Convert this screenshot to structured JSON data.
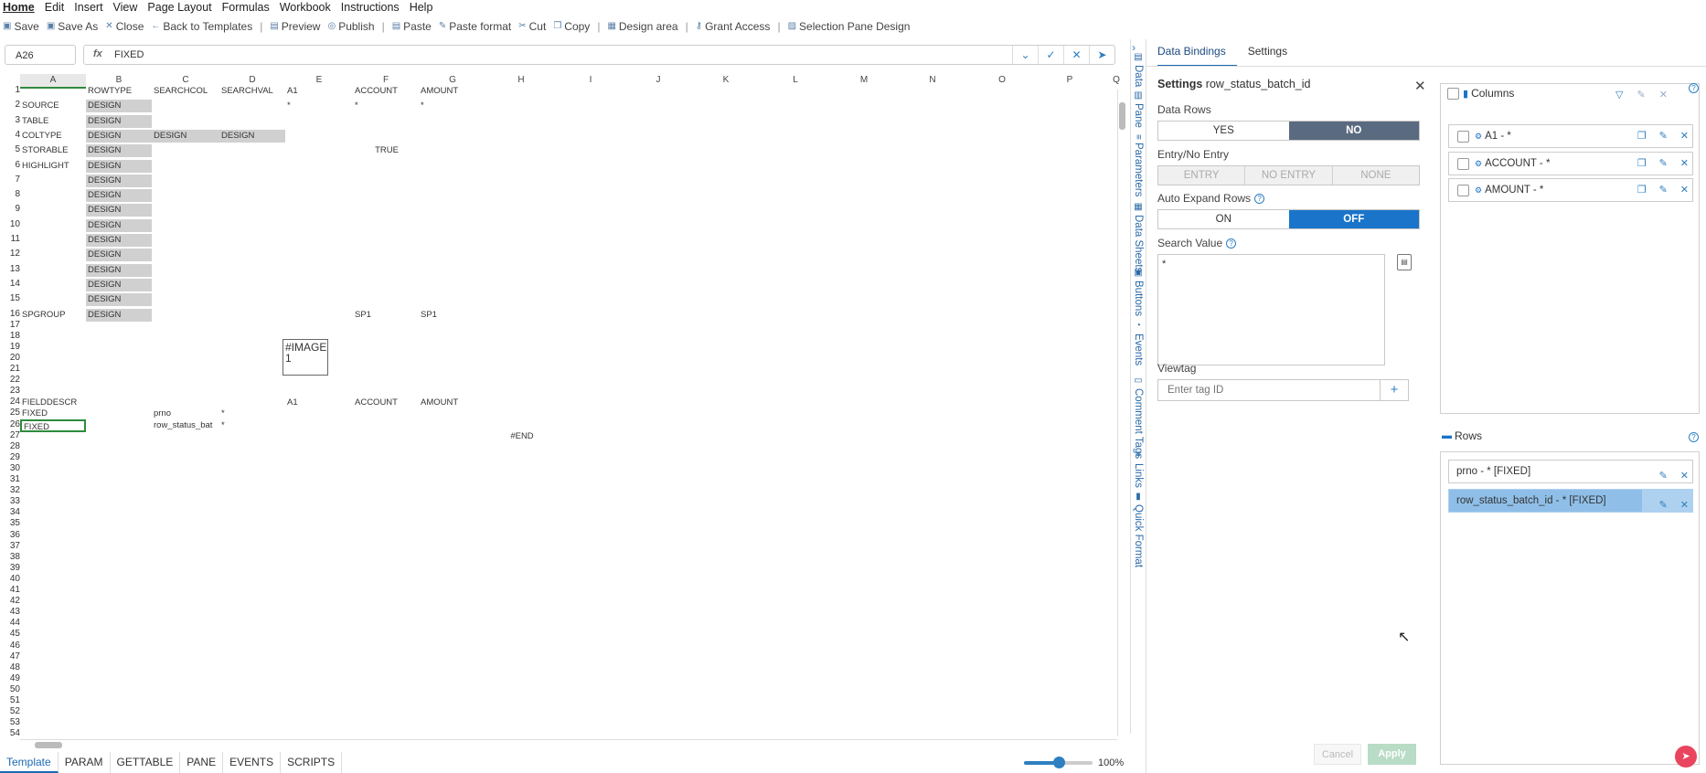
{
  "menu": [
    "Home",
    "Edit",
    "Insert",
    "View",
    "Page Layout",
    "Formulas",
    "Workbook",
    "Instructions",
    "Help"
  ],
  "toolbar": [
    {
      "label": "Save",
      "icon": "save-icon"
    },
    {
      "label": "Save As",
      "icon": "save-as-icon"
    },
    {
      "label": "Close",
      "icon": "close-icon"
    },
    {
      "label": "Back to Templates",
      "icon": "arrow-left-icon"
    },
    {
      "label": "Preview",
      "icon": "preview-icon"
    },
    {
      "label": "Publish",
      "icon": "publish-icon"
    },
    {
      "label": "Paste",
      "icon": "paste-icon"
    },
    {
      "label": "Paste format",
      "icon": "paste-format-icon"
    },
    {
      "label": "Cut",
      "icon": "cut-icon"
    },
    {
      "label": "Copy",
      "icon": "copy-icon"
    },
    {
      "label": "Design area",
      "icon": "design-area-icon"
    },
    {
      "label": "Grant Access",
      "icon": "key-icon"
    },
    {
      "label": "Selection Pane Design",
      "icon": "selection-pane-icon"
    }
  ],
  "formula_bar": {
    "cell_ref": "A26",
    "fx": "fx",
    "value": "FIXED"
  },
  "grid": {
    "columns": [
      "A",
      "B",
      "C",
      "D",
      "E",
      "F",
      "G",
      "H",
      "I",
      "J",
      "K",
      "L",
      "M",
      "N",
      "O",
      "P",
      "Q"
    ],
    "selected_column": "A",
    "row_count": 54,
    "selected_cell": "A26",
    "image_text": [
      "#IMAGE",
      "1"
    ],
    "cells": [
      {
        "r": 1,
        "c": "B",
        "t": "ROWTYPE"
      },
      {
        "r": 1,
        "c": "C",
        "t": "SEARCHCOL"
      },
      {
        "r": 1,
        "c": "D",
        "t": "SEARCHVAL"
      },
      {
        "r": 1,
        "c": "E",
        "t": "A1"
      },
      {
        "r": 1,
        "c": "F",
        "t": "ACCOUNT"
      },
      {
        "r": 1,
        "c": "G",
        "t": "AMOUNT"
      },
      {
        "r": 2,
        "c": "A",
        "t": "SOURCE"
      },
      {
        "r": 2,
        "c": "B",
        "t": "DESIGN",
        "g": true
      },
      {
        "r": 2,
        "c": "E",
        "t": "*"
      },
      {
        "r": 2,
        "c": "F",
        "t": "*"
      },
      {
        "r": 2,
        "c": "G",
        "t": "*"
      },
      {
        "r": 3,
        "c": "A",
        "t": "TABLE"
      },
      {
        "r": 3,
        "c": "B",
        "t": "DESIGN",
        "g": true
      },
      {
        "r": 4,
        "c": "A",
        "t": "COLTYPE"
      },
      {
        "r": 4,
        "c": "B",
        "t": "DESIGN",
        "g": true
      },
      {
        "r": 4,
        "c": "C",
        "t": "DESIGN",
        "g": true
      },
      {
        "r": 4,
        "c": "D",
        "t": "DESIGN",
        "g": true
      },
      {
        "r": 5,
        "c": "A",
        "t": "STORABLE"
      },
      {
        "r": 5,
        "c": "B",
        "t": "DESIGN",
        "g": true
      },
      {
        "r": 5,
        "c": "F",
        "t": "TRUE",
        "center": true
      },
      {
        "r": 6,
        "c": "A",
        "t": "HIGHLIGHT"
      },
      {
        "r": 6,
        "c": "B",
        "t": "DESIGN",
        "g": true
      },
      {
        "r": 7,
        "c": "B",
        "t": "DESIGN",
        "g": true
      },
      {
        "r": 8,
        "c": "B",
        "t": "DESIGN",
        "g": true
      },
      {
        "r": 9,
        "c": "B",
        "t": "DESIGN",
        "g": true
      },
      {
        "r": 10,
        "c": "B",
        "t": "DESIGN",
        "g": true
      },
      {
        "r": 11,
        "c": "B",
        "t": "DESIGN",
        "g": true
      },
      {
        "r": 12,
        "c": "B",
        "t": "DESIGN",
        "g": true
      },
      {
        "r": 13,
        "c": "B",
        "t": "DESIGN",
        "g": true
      },
      {
        "r": 14,
        "c": "B",
        "t": "DESIGN",
        "g": true
      },
      {
        "r": 15,
        "c": "B",
        "t": "DESIGN",
        "g": true
      },
      {
        "r": 16,
        "c": "A",
        "t": "SPGROUP"
      },
      {
        "r": 16,
        "c": "B",
        "t": "DESIGN",
        "g": true
      },
      {
        "r": 16,
        "c": "F",
        "t": "SP1"
      },
      {
        "r": 16,
        "c": "G",
        "t": "SP1"
      },
      {
        "r": 24,
        "c": "A",
        "t": "FIELDDESCR"
      },
      {
        "r": 24,
        "c": "E",
        "t": "A1"
      },
      {
        "r": 24,
        "c": "F",
        "t": "ACCOUNT"
      },
      {
        "r": 24,
        "c": "G",
        "t": "AMOUNT"
      },
      {
        "r": 25,
        "c": "A",
        "t": "FIXED"
      },
      {
        "r": 25,
        "c": "C",
        "t": "prno"
      },
      {
        "r": 25,
        "c": "D",
        "t": "*"
      },
      {
        "r": 26,
        "c": "A",
        "t": "FIXED"
      },
      {
        "r": 26,
        "c": "C",
        "t": "row_status_bat"
      },
      {
        "r": 26,
        "c": "D",
        "t": "*"
      },
      {
        "r": 27,
        "c": "H",
        "t": "#END",
        "center": true
      }
    ]
  },
  "sheet_tabs": [
    "Template",
    "PARAM",
    "GETTABLE",
    "PANE",
    "EVENTS",
    "SCRIPTS"
  ],
  "active_sheet": "Template",
  "zoom": {
    "percent": 100,
    "label": "100%"
  },
  "side_tabs": [
    {
      "label": "Data",
      "icon": "data-icon"
    },
    {
      "label": "Pane",
      "icon": "pane-icon"
    },
    {
      "label": "Parameters",
      "icon": "parameters-icon"
    },
    {
      "label": "Data Sheets",
      "icon": "data-sheets-icon"
    },
    {
      "label": "Buttons",
      "icon": "buttons-icon"
    },
    {
      "label": "Events",
      "icon": "events-icon"
    },
    {
      "label": "Comment Tags",
      "icon": "comment-tags-icon"
    },
    {
      "label": "Links",
      "icon": "links-icon"
    },
    {
      "label": "Quick Format",
      "icon": "quick-format-icon"
    }
  ],
  "panel": {
    "tabs": [
      "Data Bindings",
      "Settings"
    ],
    "active_tab": "Data Bindings",
    "settings_title": "Settings",
    "settings_subject": "row_status_batch_id",
    "data_rows": {
      "label": "Data Rows",
      "options": [
        "YES",
        "NO"
      ],
      "selected": "NO"
    },
    "entry": {
      "label": "Entry/No Entry",
      "options": [
        "ENTRY",
        "NO ENTRY",
        "NONE"
      ],
      "disabled": true
    },
    "auto_expand": {
      "label": "Auto Expand Rows",
      "options": [
        "ON",
        "OFF"
      ],
      "selected": "OFF"
    },
    "search_value": {
      "label": "Search Value",
      "value": "*"
    },
    "viewtag": {
      "label": "Viewtag",
      "placeholder": "Enter tag ID"
    },
    "cancel_label": "Cancel",
    "apply_label": "Apply",
    "columns": {
      "title": "Columns",
      "items": [
        "A1 - *",
        "ACCOUNT - *",
        "AMOUNT - *"
      ]
    },
    "rows": {
      "title": "Rows",
      "items": [
        "prno - * [FIXED]",
        "row_status_batch_id - * [FIXED]"
      ],
      "selected_index": 1
    }
  },
  "colors": {
    "accent": "#1a74c9",
    "selection_green": "#2e8b3d",
    "gray_cell": "#d0d0d0",
    "dark_segment": "#5a6a80",
    "fab": "#e9455e"
  }
}
